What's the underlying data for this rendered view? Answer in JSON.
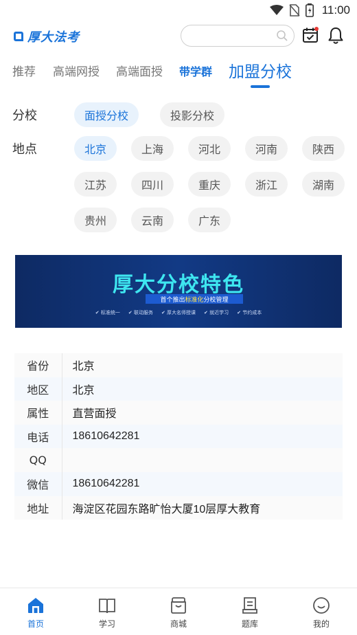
{
  "status": {
    "time": "11:00"
  },
  "header": {
    "logo_text": "厚大法考",
    "search_placeholder": ""
  },
  "tabs": [
    {
      "label": "推荐"
    },
    {
      "label": "高端网授"
    },
    {
      "label": "高端面授"
    },
    {
      "label": "带学群"
    },
    {
      "label": "加盟分校"
    }
  ],
  "filters": {
    "branch_label": "分校",
    "branch_options": [
      "面授分校",
      "投影分校"
    ],
    "branch_selected": "面授分校",
    "location_label": "地点",
    "locations": [
      "北京",
      "上海",
      "河北",
      "河南",
      "陕西",
      "江苏",
      "四川",
      "重庆",
      "浙江",
      "湖南",
      "贵州",
      "云南",
      "广东"
    ],
    "location_selected": "北京"
  },
  "banner": {
    "title": "厚大分校特色",
    "subtitle_pre": "首个推出",
    "subtitle_highlight": "标准化",
    "subtitle_post": "分校管理",
    "features": [
      "✔ 标准统一",
      "✔ 联动服务",
      "✔ 厚大名师授课",
      "✔ 就近学习",
      "✔ 节约成本"
    ]
  },
  "info": [
    {
      "key": "省份",
      "value": "北京"
    },
    {
      "key": "地区",
      "value": "北京"
    },
    {
      "key": "属性",
      "value": "直营面授"
    },
    {
      "key": "电话",
      "value": "18610642281"
    },
    {
      "key": "QQ",
      "value": ""
    },
    {
      "key": "微信",
      "value": "18610642281"
    },
    {
      "key": "地址",
      "value": "海淀区花园东路旷怡大厦10层厚大教育"
    }
  ],
  "bottom_nav": [
    {
      "label": "首页",
      "icon": "home-icon"
    },
    {
      "label": "学习",
      "icon": "book-icon"
    },
    {
      "label": "商城",
      "icon": "shop-icon"
    },
    {
      "label": "题库",
      "icon": "question-bank-icon"
    },
    {
      "label": "我的",
      "icon": "smile-icon"
    }
  ],
  "colors": {
    "accent": "#1a73d9",
    "chip_bg": "#f2f2f2",
    "chip_selected_bg": "#e8f2fc"
  }
}
